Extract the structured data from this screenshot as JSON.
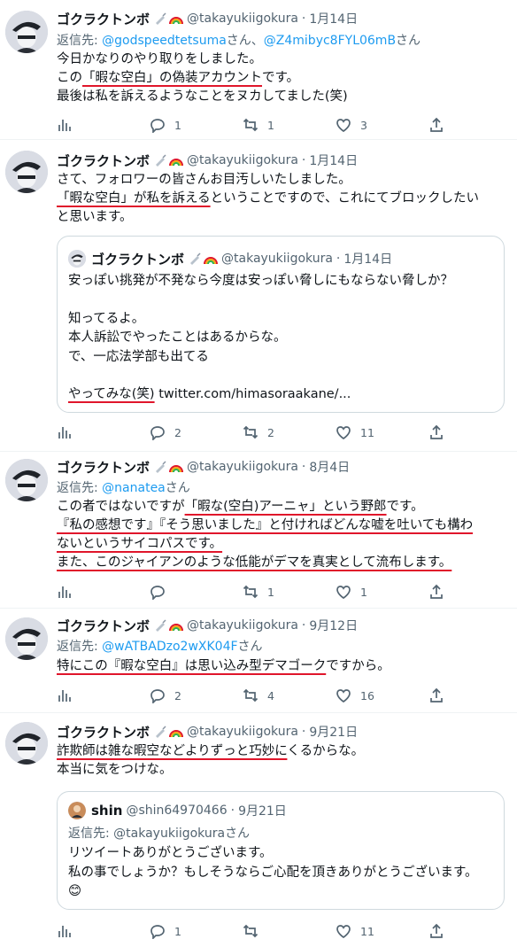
{
  "tweets": [
    {
      "name": "ゴクラクトンボ",
      "handle": "@takayukiigokura",
      "date": "1月14日",
      "reply_prefix": "返信先: ",
      "mention1": "@godspeedtetsuma",
      "mention_sep": "さん、",
      "mention2": "@Z4mibyc8FYL06mB",
      "mention_suffix": "さん",
      "line1": "今日かなりのやり取りをしました。",
      "line2_a": "この",
      "line2_u": "「暇な空白」の偽装アカウント",
      "line2_b": "です。",
      "line3": "最後は私を訴えるようなことをヌカしてました(笑)",
      "replies": "1",
      "retweets": "1",
      "likes": "3"
    },
    {
      "name": "ゴクラクトンボ",
      "handle": "@takayukiigokura",
      "date": "1月14日",
      "line1": "さて、フォロワーの皆さんお目汚しいたしました。",
      "line2_u": "「暇な空白」が私を訴える",
      "line2_b": "ということですので、これにてブロックしたい",
      "line3": "と思います。",
      "quote": {
        "name": "ゴクラクトンボ",
        "handle": "@takayukiigokura",
        "date": "1月14日",
        "l1": "安っぽい挑発が不発なら今度は安っぽい脅しにもならない脅しか？",
        "l2": "知ってるよ。",
        "l3": "本人訴訟でやったことはあるからな。",
        "l4": "で、一応法学部も出てる",
        "l5_u": "やってみな(笑)",
        "l5_link": " twitter.com/himasoraakane/..."
      },
      "replies": "2",
      "retweets": "2",
      "likes": "11"
    },
    {
      "name": "ゴクラクトンボ",
      "handle": "@takayukiigokura",
      "date": "8月4日",
      "reply_prefix": "返信先: ",
      "mention1": "@nanatea",
      "mention_suffix": "さん",
      "line1_a": "この者ではないですが",
      "line1_u": "「暇な(空白)アーニャ」という野郎",
      "line1_b": "です。",
      "line2_u": "『私の感想です』『そう思いました』と付ければどんな嘘を吐いても構わ",
      "line3_u": "ないというサイコパスです。",
      "line4_u": "また、このジャイアンのような低能がデマを真実として流布します。",
      "replies": "",
      "retweets": "1",
      "likes": "1"
    },
    {
      "name": "ゴクラクトンボ",
      "handle": "@takayukiigokura",
      "date": "9月12日",
      "reply_prefix": "返信先: ",
      "mention1": "@wATBADzo2wXK04F",
      "mention_suffix": "さん",
      "line1_u": "特にこの『暇な空白』は思い込み型デマゴーク",
      "line1_b": "ですから。",
      "replies": "2",
      "retweets": "4",
      "likes": "16"
    },
    {
      "name": "ゴクラクトンボ",
      "handle": "@takayukiigokura",
      "date": "9月21日",
      "line1_u": "詐欺師は雑な暇空などよりずっと巧妙に",
      "line1_b": "くるからな。",
      "line2": "本当に気をつけな。",
      "quote": {
        "name": "shin",
        "handle": "@shin64970466",
        "date": "9月21日",
        "reply_prefix": "返信先: ",
        "mention1": "@takayukiigokura",
        "mention_suffix": "さん",
        "l1": "リツイートありがとうございます。",
        "l2": "私の事でしょうか？もしそうならご心配を頂きありがとうございます。",
        "l3": "😊"
      },
      "replies": "1",
      "retweets": "",
      "likes": "11"
    }
  ],
  "sep": " · ",
  "icons": [
    "analytics-icon",
    "reply-icon",
    "retweet-icon",
    "like-icon",
    "share-icon"
  ]
}
